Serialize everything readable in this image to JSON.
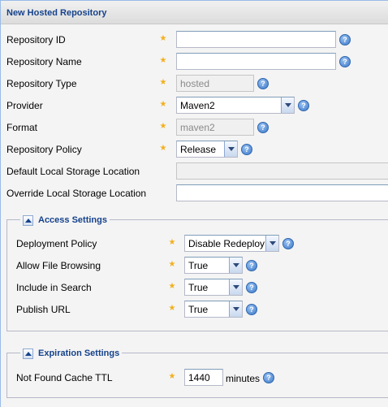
{
  "panel": {
    "title": "New Hosted Repository"
  },
  "fields": {
    "repository_id": {
      "label": "Repository ID",
      "value": ""
    },
    "repository_name": {
      "label": "Repository Name",
      "value": ""
    },
    "repository_type": {
      "label": "Repository Type",
      "value": "hosted"
    },
    "provider": {
      "label": "Provider",
      "value": "Maven2"
    },
    "format": {
      "label": "Format",
      "value": "maven2"
    },
    "repository_policy": {
      "label": "Repository Policy",
      "value": "Release"
    },
    "default_local_storage": {
      "label": "Default Local Storage Location",
      "value": ""
    },
    "override_local_storage": {
      "label": "Override Local Storage Location",
      "value": ""
    }
  },
  "access_settings": {
    "title": "Access Settings",
    "deployment_policy": {
      "label": "Deployment Policy",
      "value": "Disable Redeploy"
    },
    "allow_file_browsing": {
      "label": "Allow File Browsing",
      "value": "True"
    },
    "include_in_search": {
      "label": "Include in Search",
      "value": "True"
    },
    "publish_url": {
      "label": "Publish URL",
      "value": "True"
    }
  },
  "expiration_settings": {
    "title": "Expiration Settings",
    "not_found_cache_ttl": {
      "label": "Not Found Cache TTL",
      "value": "1440",
      "unit": "minutes"
    }
  },
  "icons": {
    "required": "star-icon",
    "help": "help-icon",
    "help_glyph": "?",
    "required_glyph": "★"
  },
  "colors": {
    "accent": "#15428b",
    "required_star": "#f2b01e",
    "help_blue": "#3a78c8"
  }
}
